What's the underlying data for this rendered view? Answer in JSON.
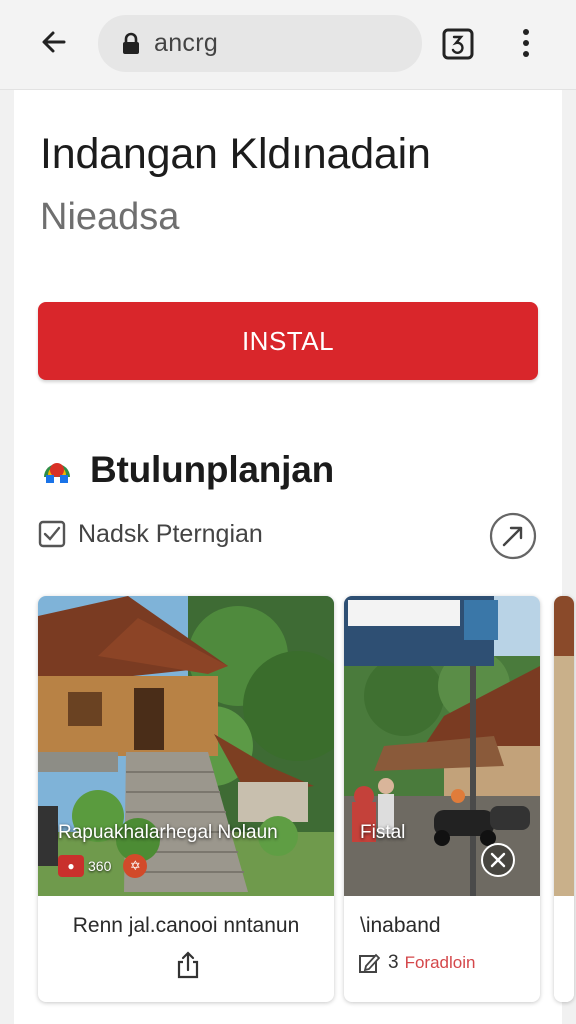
{
  "browser": {
    "url": "ancrg",
    "icons": {
      "back": "arrow-left-icon",
      "lock": "lock-icon",
      "tabs": "tab-switcher-icon",
      "menu": "more-vert-icon"
    }
  },
  "app": {
    "title": "Indangan Kldınadain",
    "subtitle": "Nieadsa",
    "install_label": "INSTAL",
    "install_color": "#d9262b"
  },
  "section": {
    "title": "Btulunplanjan",
    "check_label": "Nadsk Pterngian"
  },
  "cards": [
    {
      "overlay_title": "Rapuakhalarhegal Nolaun",
      "badge_count": "360",
      "caption": "Renn jal.canooi nntanun"
    },
    {
      "overlay_title": "Fistal",
      "caption": "\\inaband",
      "meta_count": "3",
      "meta_tag": "Foradloin"
    }
  ]
}
